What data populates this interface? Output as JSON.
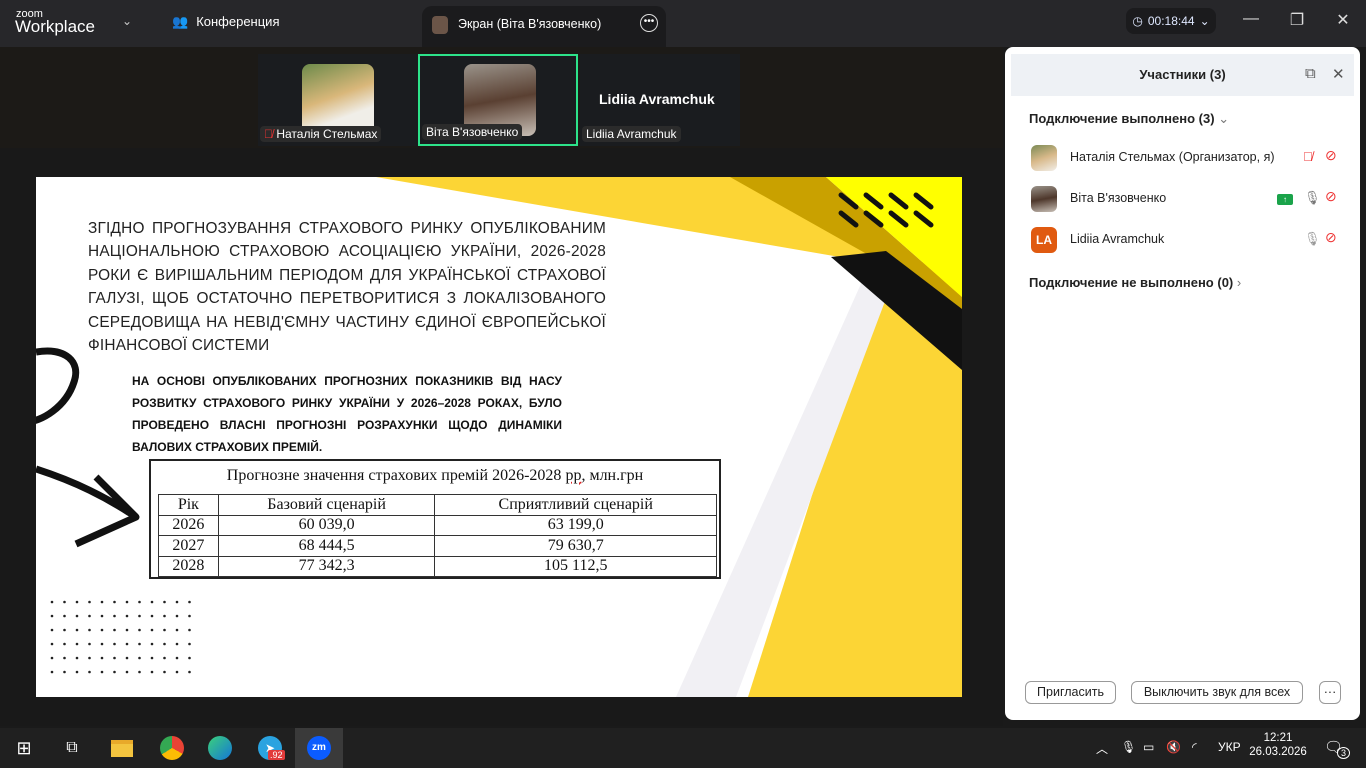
{
  "app": {
    "logo_small": "zoom",
    "logo_big": "Workplace",
    "meeting_tab": "Конференция",
    "screen_tab": "Экран (Віта В'язовченко)",
    "timer": "00:18:44"
  },
  "thumbnails": [
    {
      "name": "Наталія Стельмах",
      "muted": true
    },
    {
      "name": "Віта В'язовченко",
      "active": true
    },
    {
      "name": "Lidiia Avramchuk",
      "title": "Lidiia Avramchuk"
    }
  ],
  "slide": {
    "heading": "ЗГІДНО ПРОГНОЗУВАННЯ СТРАХОВОГО РИНКУ ОПУБЛІКОВАНИМ НАЦІОНАЛЬНОЮ СТРАХОВОЮ АСОЦІАЦІЄЮ УКРАЇНИ, 2026-2028 РОКИ Є ВИРІШАЛЬНИМ ПЕРІОДОМ ДЛЯ УКРАЇНСЬКОЇ СТРАХОВОЇ ГАЛУЗІ, ЩОБ ОСТАТОЧНО ПЕРЕТВОРИТИСЯ З ЛОКАЛІЗОВАНОГО СЕРЕДОВИЩА НА НЕВІД'ЄМНУ ЧАСТИНУ ЄДИНОЇ ЄВРОПЕЙСЬКОЇ ФІНАНСОВОЇ СИСТЕМИ",
    "subtext": "НА ОСНОВІ ОПУБЛІКОВАНИХ ПРОГНОЗНИХ ПОКАЗНИКІВ ВІД НАСУ РОЗВИТКУ СТРАХОВОГО РИНКУ УКРАЇНИ У 2026–2028 РОКАХ, БУЛО ПРОВЕДЕНО ВЛАСНІ ПРОГНОЗНІ РОЗРАХУНКИ ЩОДО ДИНАМІКИ ВАЛОВИХ СТРАХОВИХ ПРЕМІЙ.",
    "table": {
      "caption_main": "Прогнозне значення страхових премій 2026-2028 ",
      "caption_underlined": "рр",
      "caption_rest": ", млн.грн",
      "headers": [
        "Рік",
        "Базовий сценарій",
        "Сприятливий сценарій"
      ],
      "rows": [
        [
          "2026",
          "60 039,0",
          "63 199,0"
        ],
        [
          "2027",
          "68 444,5",
          "79 630,7"
        ],
        [
          "2028",
          "77  342,3",
          "105 112,5"
        ]
      ]
    },
    "colors": {
      "yellow": "#fcd535",
      "gold": "#c9a100",
      "bright_yellow": "#ffff00",
      "black": "#111111"
    }
  },
  "panel": {
    "title": "Участники (3)",
    "connected": "Подключение выполнено (3)",
    "not_connected": "Подключение не выполнено (0)",
    "participants": [
      {
        "name": "Наталія Стельмах (Организатор, я)",
        "mic": "muted",
        "video": "off"
      },
      {
        "name": "Віта В'язовченко",
        "sharing": true,
        "mic": "on",
        "video": "off"
      },
      {
        "name": "Lidiia Avramchuk",
        "initials": "LA",
        "mic": "on",
        "video": "off",
        "avatar_color": "#e05a10"
      }
    ],
    "invite": "Пригласить",
    "mute_all": "Выключить звук для всех",
    "more": "···"
  },
  "taskbar": {
    "telegram_badge": ".92",
    "lang": "УКР",
    "time": "12:21",
    "date": "26.03.2026",
    "notifications": "3"
  }
}
